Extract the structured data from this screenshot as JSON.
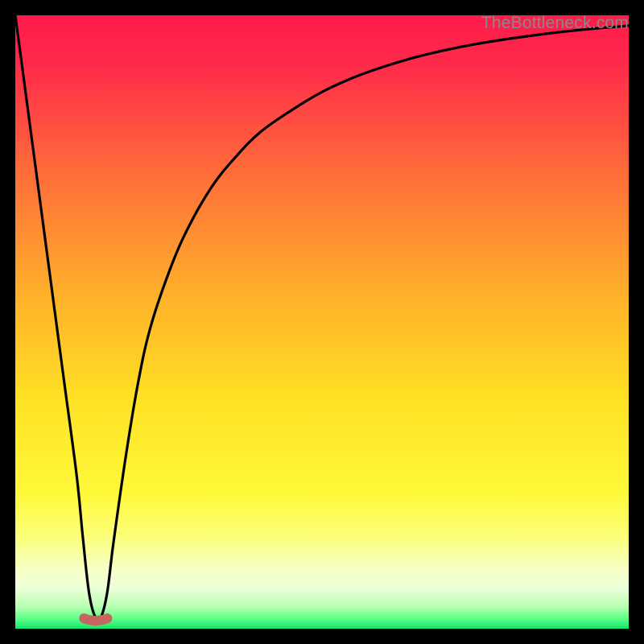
{
  "watermark": "TheBottleneck.com",
  "colors": {
    "gradient_stops": [
      {
        "offset": 0.0,
        "color": "#ff1a4a"
      },
      {
        "offset": 0.08,
        "color": "#ff2a4a"
      },
      {
        "offset": 0.25,
        "color": "#ff6a3a"
      },
      {
        "offset": 0.45,
        "color": "#ffae2a"
      },
      {
        "offset": 0.62,
        "color": "#ffe024"
      },
      {
        "offset": 0.78,
        "color": "#fff93a"
      },
      {
        "offset": 0.85,
        "color": "#fbff7a"
      },
      {
        "offset": 0.905,
        "color": "#f6ffc8"
      },
      {
        "offset": 0.935,
        "color": "#eaffd8"
      },
      {
        "offset": 0.965,
        "color": "#b6ffb0"
      },
      {
        "offset": 0.985,
        "color": "#54ff84"
      },
      {
        "offset": 1.0,
        "color": "#14e56a"
      }
    ],
    "curve": "#000000",
    "minimum_marker": "#c6675f",
    "frame": "#000000"
  },
  "chart_data": {
    "type": "line",
    "title": "",
    "xlabel": "",
    "ylabel": "",
    "xlim": [
      0,
      100
    ],
    "ylim": [
      0,
      100
    ],
    "x": [
      0,
      2,
      4,
      6,
      8,
      10,
      11,
      12,
      13,
      14,
      15,
      16,
      18,
      20,
      22,
      25,
      28,
      32,
      36,
      40,
      45,
      50,
      55,
      60,
      65,
      70,
      75,
      80,
      85,
      90,
      95,
      100
    ],
    "values": [
      100,
      85,
      70,
      55,
      40,
      25,
      15,
      6,
      2,
      2,
      6,
      14,
      28,
      40,
      49,
      58,
      65,
      72,
      77,
      81,
      84.5,
      87.5,
      89.8,
      91.6,
      93.1,
      94.3,
      95.3,
      96.1,
      96.8,
      97.4,
      97.9,
      98.3
    ],
    "series_name": "bottleneck_curve",
    "minimum": {
      "x_start": 11.2,
      "x_end": 15.0,
      "y": 1.7
    }
  }
}
